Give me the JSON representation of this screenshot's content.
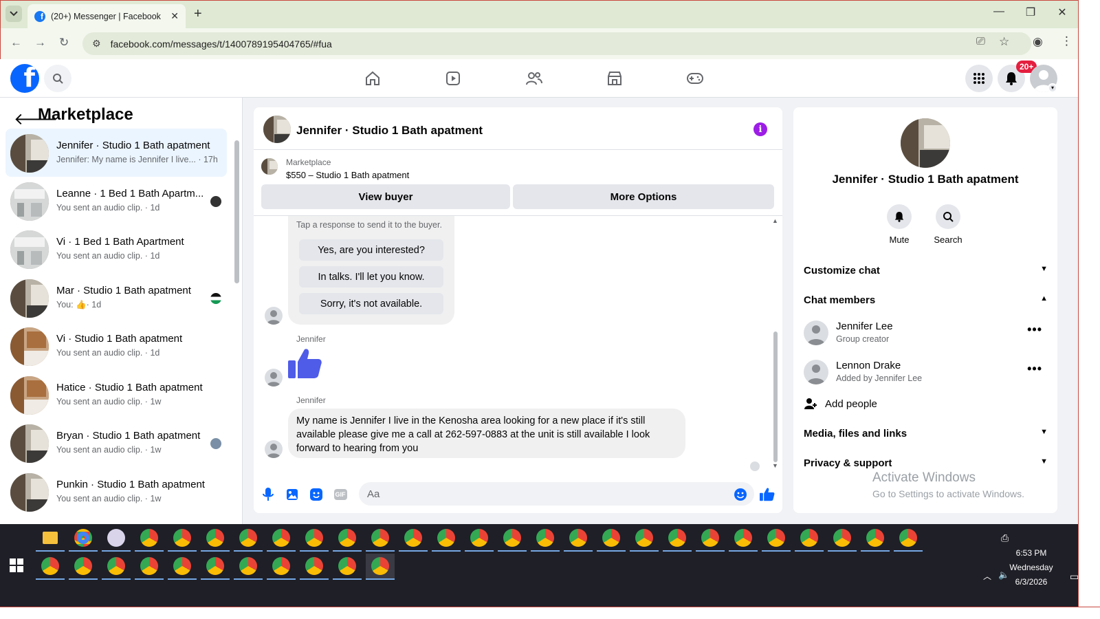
{
  "browser": {
    "tab_title": "(20+) Messenger | Facebook",
    "url": "facebook.com/messages/t/1400789195404765/#fua"
  },
  "header": {
    "notification_badge": "20+",
    "brand_color": "#0866ff"
  },
  "sidebar": {
    "title": "Marketplace",
    "conversations": [
      {
        "name": "Jennifer · Studio 1 Bath apatment",
        "preview": "Jennifer: My name is Jennifer I live... · 17h",
        "active": true
      },
      {
        "name": "Leanne · 1 Bed 1 Bath Apartm...",
        "preview": "You sent an audio clip. · 1d"
      },
      {
        "name": "Vi · 1 Bed 1 Bath Apartment",
        "preview": "You sent an audio clip. · 1d"
      },
      {
        "name": "Mar · Studio 1 Bath apatment",
        "preview_prefix": "You:",
        "preview_suffix": "· 1d"
      },
      {
        "name": "Vi · Studio 1 Bath apatment",
        "preview": "You sent an audio clip. · 1d"
      },
      {
        "name": "Hatice · Studio 1 Bath apatment",
        "preview": "You sent an audio clip. · 1w"
      },
      {
        "name": "Bryan · Studio 1 Bath apatment",
        "preview": "You sent an audio clip. · 1w"
      },
      {
        "name": "Punkin · Studio 1 Bath apatment",
        "preview": "You sent an audio clip. · 1w"
      }
    ]
  },
  "chat": {
    "title": "Jennifer · Studio 1 Bath apatment",
    "marketplace_label": "Marketplace",
    "listing": "$550 – Studio 1 Bath apatment",
    "view_buyer": "View buyer",
    "more_options": "More Options",
    "quick_hint": "Tap a response to send it to the buyer.",
    "quick_replies": [
      "Yes, are you interested?",
      "In talks. I'll let you know.",
      "Sorry, it's not available."
    ],
    "sender1": "Jennifer",
    "sender2": "Jennifer",
    "message": "My name is Jennifer I live in the Kenosha area looking for a new place if it's still available please give me a call at 262-597-0883 at the unit is still available I look forward to hearing from you",
    "composer_placeholder": "Aa"
  },
  "details": {
    "name": "Jennifer · Studio 1 Bath apatment",
    "mute": "Mute",
    "search": "Search",
    "customize_chat": "Customize chat",
    "chat_members": "Chat members",
    "members": [
      {
        "name": "Jennifer Lee",
        "role": "Group creator"
      },
      {
        "name": "Lennon Drake",
        "role": "Added by Jennifer Lee"
      }
    ],
    "add_people": "Add people",
    "media_files": "Media, files and links",
    "privacy": "Privacy & support"
  },
  "watermark": {
    "line1": "Activate Windows",
    "line2": "Go to Settings to activate Windows."
  },
  "taskbar": {
    "time": "6:53 PM",
    "day": "Wednesday",
    "date": "6/3/2026"
  }
}
